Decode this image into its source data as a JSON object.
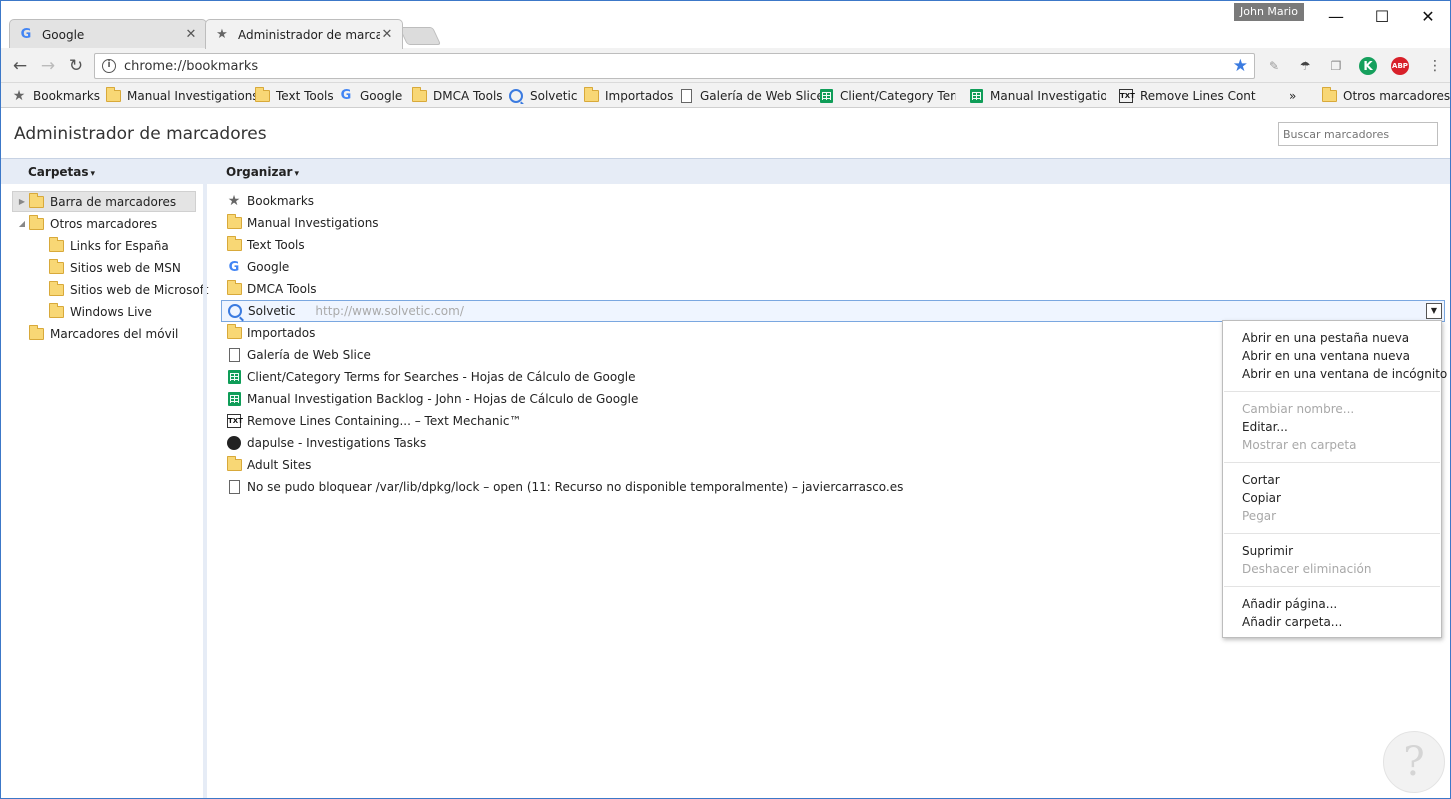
{
  "window": {
    "user": "John Mario",
    "controls": {
      "minimize": "—",
      "maximize": "☐",
      "close": "✕"
    }
  },
  "tabs": [
    {
      "label": "Google",
      "favicon": "google-icon",
      "close": "✕"
    },
    {
      "label": "Administrador de marcadores",
      "favicon": "star-icon",
      "close": "✕"
    }
  ],
  "toolbar": {
    "url": "chrome://bookmarks",
    "back": "←",
    "forward": "→",
    "reload": "↻",
    "info": "i",
    "star": "★",
    "ext_k": "K",
    "ext_abp": "ABP",
    "menu": "⋮"
  },
  "bookmarks_bar": {
    "items": [
      {
        "label": "Bookmarks",
        "icon": "star-icon"
      },
      {
        "label": "Manual Investigations",
        "icon": "folder-icon"
      },
      {
        "label": "Text Tools",
        "icon": "folder-icon"
      },
      {
        "label": "Google",
        "icon": "google-icon"
      },
      {
        "label": "DMCA Tools",
        "icon": "folder-icon"
      },
      {
        "label": "Solvetic",
        "icon": "solvetic-icon"
      },
      {
        "label": "Importados",
        "icon": "folder-icon"
      },
      {
        "label": "Galería de Web Slice",
        "icon": "page-icon"
      },
      {
        "label": "Client/Category Terms",
        "icon": "sheets-icon"
      },
      {
        "label": "Manual Investigation",
        "icon": "sheets-icon"
      },
      {
        "label": "Remove Lines Contain",
        "icon": "text-mechanic-icon"
      }
    ],
    "overflow": "»",
    "other": "Otros marcadores"
  },
  "page": {
    "title": "Administrador de marcadores",
    "search_placeholder": "Buscar marcadores"
  },
  "columns": {
    "folders": "Carpetas",
    "organize": "Organizar",
    "caret": "▾"
  },
  "tree": [
    {
      "label": "Barra de marcadores",
      "twisty": "▶"
    },
    {
      "label": "Otros marcadores",
      "twisty": "◢"
    },
    {
      "label": "Links for España"
    },
    {
      "label": "Sitios web de MSN"
    },
    {
      "label": "Sitios web de Microsoft"
    },
    {
      "label": "Windows Live"
    },
    {
      "label": "Marcadores del móvil"
    }
  ],
  "list": [
    {
      "name": "Bookmarks",
      "icon": "star-icon"
    },
    {
      "name": "Manual Investigations",
      "icon": "folder-icon"
    },
    {
      "name": "Text Tools",
      "icon": "folder-icon"
    },
    {
      "name": "Google",
      "icon": "google-icon"
    },
    {
      "name": "DMCA Tools",
      "icon": "folder-icon"
    },
    {
      "name": "Solvetic",
      "url": "http://www.solvetic.com/",
      "icon": "solvetic-icon"
    },
    {
      "name": "Importados",
      "icon": "folder-icon"
    },
    {
      "name": "Galería de Web Slice",
      "icon": "page-icon"
    },
    {
      "name": "Client/Category Terms for Searches - Hojas de Cálculo de Google",
      "icon": "sheets-icon"
    },
    {
      "name": "Manual Investigation Backlog - John - Hojas de Cálculo de Google",
      "icon": "sheets-icon"
    },
    {
      "name": "Remove Lines Containing... – Text Mechanic™",
      "icon": "text-mechanic-icon"
    },
    {
      "name": "dapulse - Investigations Tasks",
      "icon": "dapulse-icon"
    },
    {
      "name": "Adult Sites",
      "icon": "folder-icon"
    },
    {
      "name": "No se pudo bloquear /var/lib/dpkg/lock – open (11: Recurso no disponible temporalmente) – javiercarrasco.es",
      "icon": "page-icon"
    }
  ],
  "row_dropdown": "▼",
  "context_menu": [
    {
      "label": "Abrir en una pestaña nueva",
      "enabled": true
    },
    {
      "label": "Abrir en una ventana nueva",
      "enabled": true
    },
    {
      "label": "Abrir en una ventana de incógnito",
      "enabled": true
    },
    {
      "label": "Cambiar nombre...",
      "enabled": false
    },
    {
      "label": "Editar...",
      "enabled": true
    },
    {
      "label": "Mostrar en carpeta",
      "enabled": false
    },
    {
      "label": "Cortar",
      "enabled": true
    },
    {
      "label": "Copiar",
      "enabled": true
    },
    {
      "label": "Pegar",
      "enabled": false
    },
    {
      "label": "Suprimir",
      "enabled": true
    },
    {
      "label": "Deshacer eliminación",
      "enabled": false
    },
    {
      "label": "Añadir página...",
      "enabled": true
    },
    {
      "label": "Añadir carpeta...",
      "enabled": true
    }
  ],
  "watermark": "?"
}
